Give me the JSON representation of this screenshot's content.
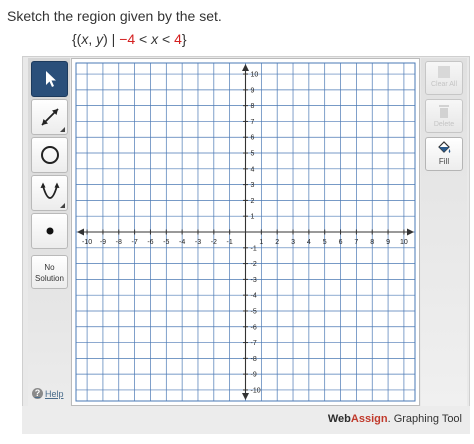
{
  "question": {
    "prompt": "Sketch the region given by the set.",
    "set_open": "{(",
    "var_x": "x",
    "comma": ", ",
    "var_y": "y",
    "bar": ") | ",
    "lower": "−4",
    "lt1": " < ",
    "var_x2": "x",
    "lt2": " < ",
    "upper": "4",
    "set_close": "}"
  },
  "tools": {
    "no_solution_line1": "No",
    "no_solution_line2": "Solution",
    "help": "Help"
  },
  "right_tools": {
    "clear_all": "Clear All",
    "delete": "Delete",
    "fill": "Fill"
  },
  "graph": {
    "x_range": [
      -10,
      10
    ],
    "y_range": [
      -10,
      10
    ],
    "tick_step": 1,
    "x_tick_labels": [
      "-10",
      "-9",
      "-8",
      "-7",
      "-6",
      "-5",
      "-4",
      "-3",
      "-2",
      "-1",
      "1",
      "2",
      "3",
      "4",
      "5",
      "6",
      "7",
      "8",
      "9",
      "10"
    ],
    "y_tick_labels": [
      "10",
      "9",
      "8",
      "7",
      "6",
      "5",
      "4",
      "3",
      "2",
      "1",
      "-1",
      "-2",
      "-3",
      "-4",
      "-5",
      "-6",
      "-7",
      "-8",
      "-9",
      "-10"
    ],
    "grid_color": "#4a78b4",
    "axis_color": "#333333"
  },
  "footer": {
    "brand_web": "Web",
    "brand_assign": "Assign",
    "brand_rest": ". Graphing Tool"
  },
  "colors": {
    "accent_red": "#d42020",
    "active_tool": "#2a4f7a"
  }
}
